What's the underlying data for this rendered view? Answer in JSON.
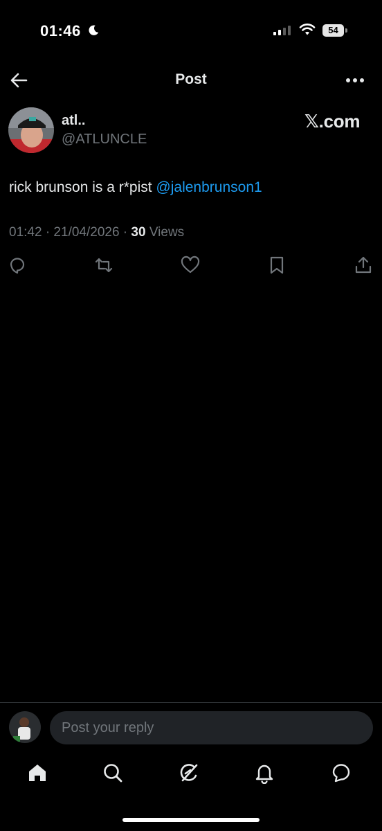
{
  "status_bar": {
    "time": "01:46",
    "battery": "54"
  },
  "header": {
    "title": "Post"
  },
  "post": {
    "author_name": "atl..",
    "author_handle": "@ATLUNCLE",
    "source_label": "𝕏.com",
    "text_before": "rick brunson is a r*pist ",
    "mention": "@jalenbrunson1",
    "timestamp": "01:42 · 21/04/2026 · ",
    "views_count": "30",
    "views_label": " Views"
  },
  "reply": {
    "placeholder": "Post your reply"
  },
  "colors": {
    "accent": "#1d9bf0",
    "muted": "#71767b",
    "background": "#000000"
  },
  "icons": {
    "actions": [
      "reply-icon",
      "repost-icon",
      "like-icon",
      "bookmark-icon",
      "share-icon"
    ],
    "tabs": [
      "home-icon",
      "search-icon",
      "grok-icon",
      "notifications-icon",
      "messages-icon"
    ]
  }
}
